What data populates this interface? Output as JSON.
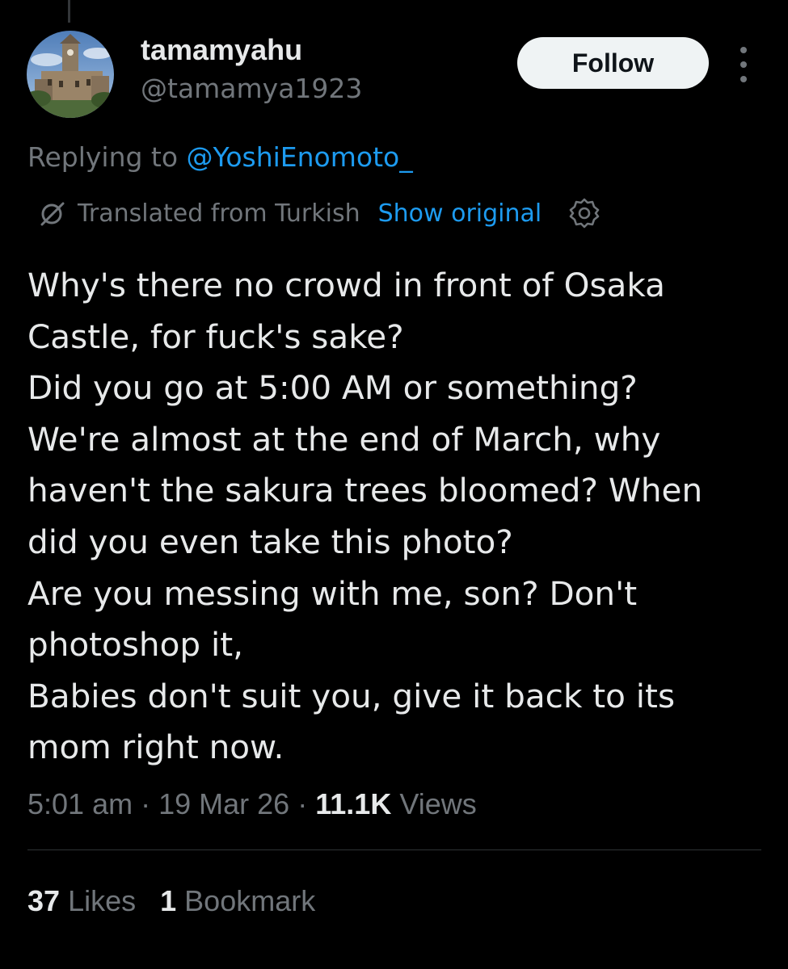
{
  "user": {
    "display_name": "tamamyahu",
    "handle": "@tamamya1923"
  },
  "follow_button": {
    "label": "Follow"
  },
  "reply": {
    "prefix": "Replying to",
    "mention": "@YoshiEnomoto_"
  },
  "translation": {
    "label": "Translated from Turkish",
    "show_original": "Show original"
  },
  "tweet": {
    "lines": [
      "Why's there no crowd in front of Osaka",
      "Castle, for fuck's sake?",
      "Did you go at 5:00 AM or something?",
      "We're almost at the end of March, why",
      "haven't the sakura trees bloomed? When",
      "did you even take this photo?",
      "Are you messing with me, son? Don't",
      "photoshop it,",
      "Babies don't suit you, give it back to its",
      "mom right now."
    ]
  },
  "meta": {
    "time": "5:01 am",
    "separator": "·",
    "date": "19 Mar 26",
    "views_count": "11.1K",
    "views_label": "Views"
  },
  "stats": {
    "likes_count": "37",
    "likes_label": "Likes",
    "bookmarks_count": "1",
    "bookmarks_label": "Bookmark"
  },
  "icons": {
    "translate": "translate-icon",
    "settings": "gear-icon",
    "more": "more-dots-icon"
  },
  "colors": {
    "background": "#000000",
    "text_primary": "#e7e9ea",
    "text_secondary": "#71767b",
    "accent": "#1d9bf0",
    "follow_bg": "#eff3f4",
    "divider": "#2f3336"
  }
}
